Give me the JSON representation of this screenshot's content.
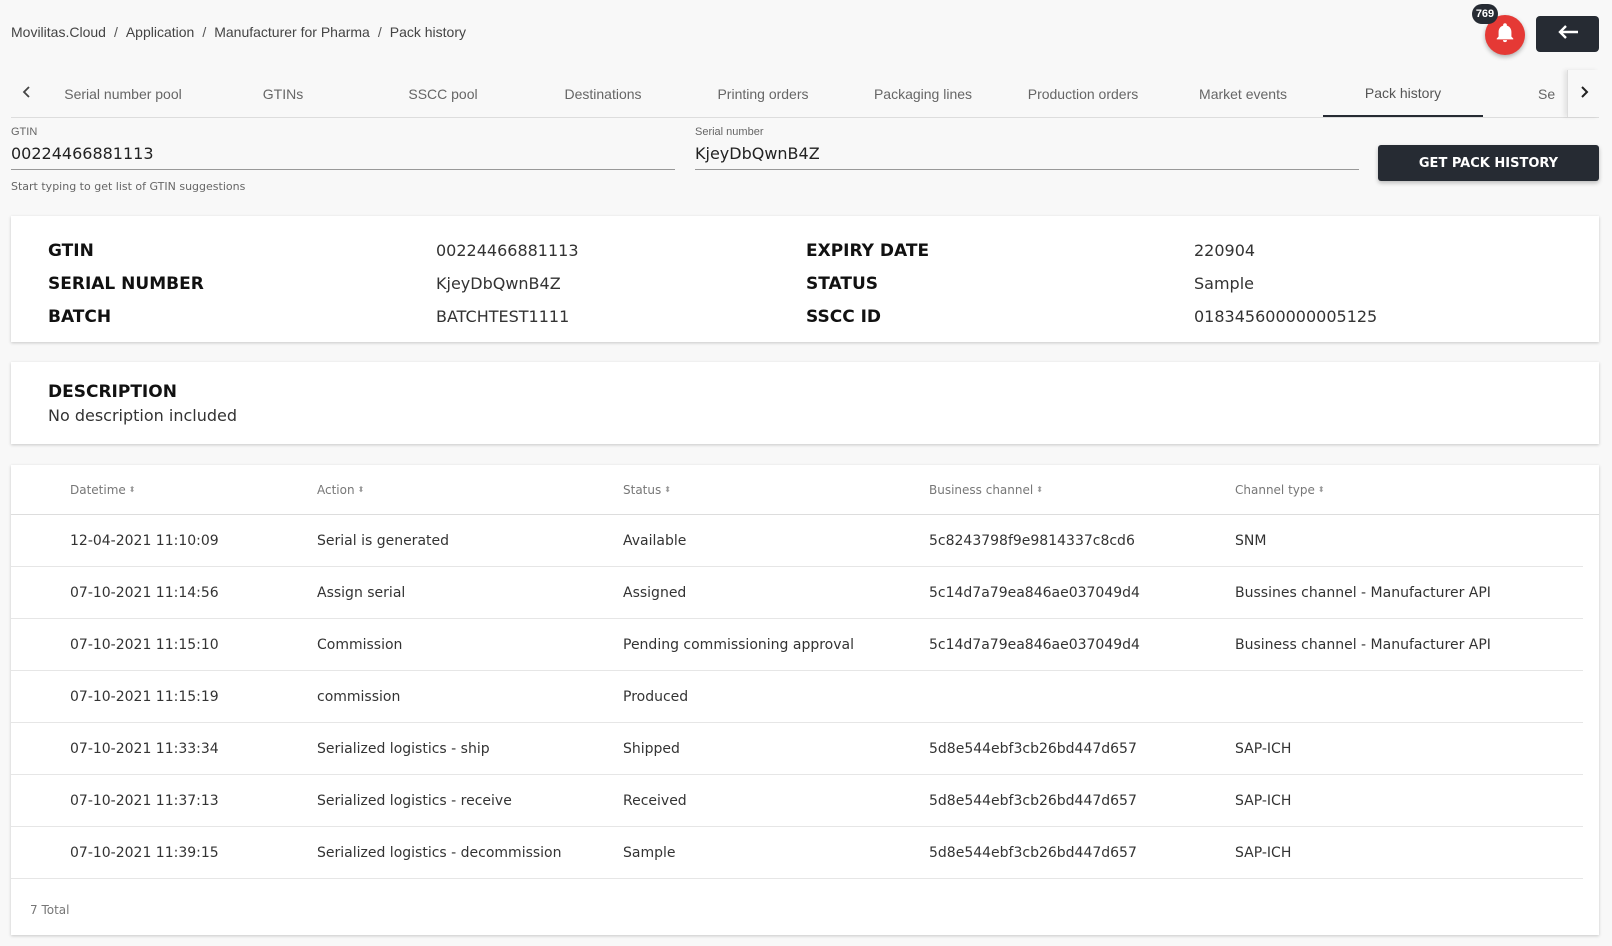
{
  "breadcrumb": [
    "Movilitas.Cloud",
    "Application",
    "Manufacturer for Pharma",
    "Pack history"
  ],
  "notifications": {
    "count": "769",
    "icon": "bell-icon",
    "color": "#e53935"
  },
  "back_button": {
    "icon": "arrow-left-icon"
  },
  "tabs": [
    {
      "label": "Serial number pool"
    },
    {
      "label": "GTINs"
    },
    {
      "label": "SSCC pool"
    },
    {
      "label": "Destinations"
    },
    {
      "label": "Printing orders"
    },
    {
      "label": "Packaging lines"
    },
    {
      "label": "Production orders"
    },
    {
      "label": "Market events"
    },
    {
      "label": "Pack history",
      "active": true
    },
    {
      "label": "Se"
    }
  ],
  "search": {
    "gtin_label": "GTIN",
    "gtin_value": "00224466881113",
    "gtin_hint": "Start typing to get list of GTIN suggestions",
    "serial_label": "Serial number",
    "serial_value": "KjeyDbQwnB4Z",
    "button_label": "GET PACK HISTORY"
  },
  "info": {
    "gtin_key": "GTIN",
    "gtin_val": "00224466881113",
    "serial_key": "SERIAL NUMBER",
    "serial_val": "KjeyDbQwnB4Z",
    "batch_key": "BATCH",
    "batch_val": "BATCHTEST1111",
    "expiry_key": "EXPIRY DATE",
    "expiry_val": "220904",
    "status_key": "STATUS",
    "status_val": "Sample",
    "sscc_key": "SSCC ID",
    "sscc_val": "018345600000005125"
  },
  "description": {
    "title": "DESCRIPTION",
    "text": "No description included"
  },
  "table": {
    "columns": [
      "Datetime",
      "Action",
      "Status",
      "Business channel",
      "Channel type"
    ],
    "rows": [
      [
        "12-04-2021 11:10:09",
        "Serial is generated",
        "Available",
        "5c8243798f9e9814337c8cd6",
        "SNM"
      ],
      [
        "07-10-2021 11:14:56",
        "Assign serial",
        "Assigned",
        "5c14d7a79ea846ae037049d4",
        "Bussines channel - Manufacturer API"
      ],
      [
        "07-10-2021 11:15:10",
        "Commission",
        "Pending commissioning approval",
        "5c14d7a79ea846ae037049d4",
        "Business channel - Manufacturer API"
      ],
      [
        "07-10-2021 11:15:19",
        "commission",
        "Produced",
        "",
        ""
      ],
      [
        "07-10-2021 11:33:34",
        "Serialized logistics - ship",
        "Shipped",
        "5d8e544ebf3cb26bd447d657",
        "SAP-ICH"
      ],
      [
        "07-10-2021 11:37:13",
        "Serialized logistics - receive",
        "Received",
        "5d8e544ebf3cb26bd447d657",
        "SAP-ICH"
      ],
      [
        "07-10-2021 11:39:15",
        "Serialized logistics - decommission",
        "Sample",
        "5d8e544ebf3cb26bd447d657",
        "SAP-ICH"
      ]
    ],
    "total": "7 Total"
  }
}
